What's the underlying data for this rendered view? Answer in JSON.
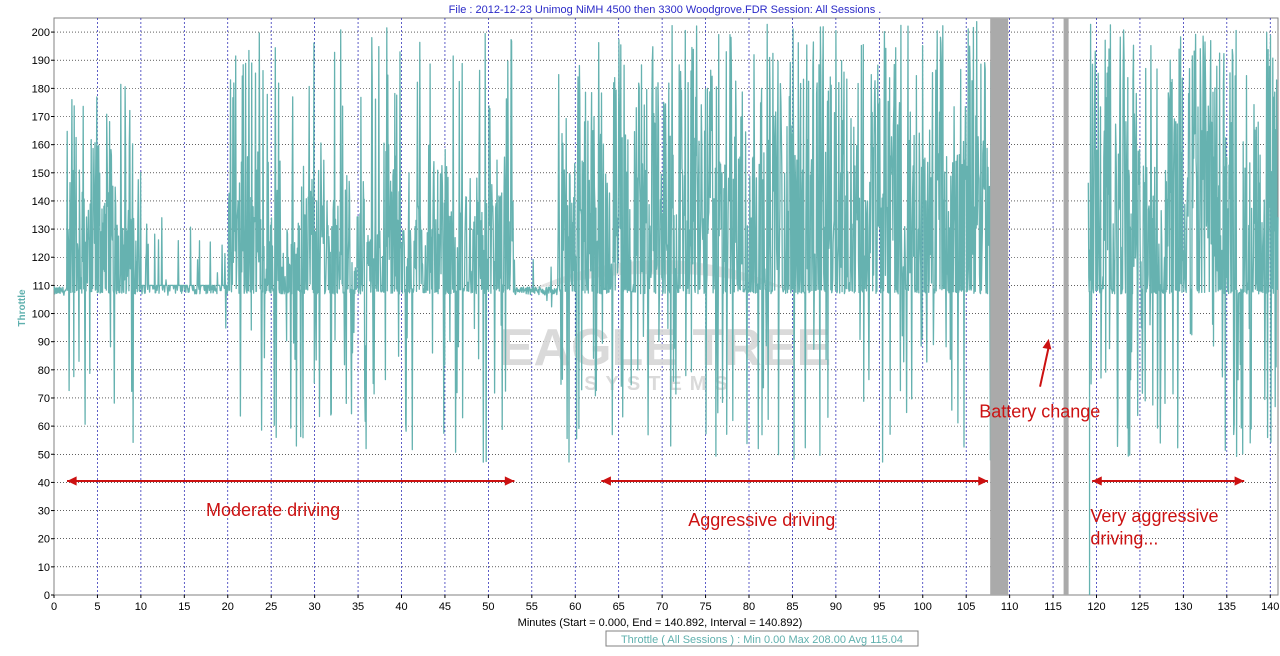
{
  "header": {
    "file_title": "File : 2012-12-23 Unimog NiMH 4500 then 3300 Woodgrove.FDR   Session: All Sessions ."
  },
  "watermark": {
    "main": "EAGLE TREE",
    "sub": "SYSTEMS"
  },
  "legend": {
    "text": "Throttle ( All Sessions ) : Min 0.00    Max 208.00    Avg 115.04"
  },
  "chart_data": {
    "type": "line",
    "xlabel": "Minutes (Start = 0.000,  End = 140.892,  Interval = 140.892)",
    "ylabel": "Throttle",
    "xlim": [
      0,
      140.892
    ],
    "ylim": [
      0,
      205
    ],
    "xticks": [
      0,
      5,
      10,
      15,
      20,
      25,
      30,
      35,
      40,
      45,
      50,
      55,
      60,
      65,
      70,
      75,
      80,
      85,
      90,
      95,
      100,
      105,
      110,
      115,
      120,
      125,
      130,
      135,
      140
    ],
    "yticks": [
      0,
      10,
      20,
      30,
      40,
      50,
      60,
      70,
      80,
      90,
      100,
      110,
      120,
      130,
      140,
      150,
      160,
      170,
      180,
      190,
      200
    ],
    "grid": true,
    "series": [
      {
        "name": "Throttle ( All Sessions )",
        "color": "#66b2b0",
        "baseline": 108,
        "note_segments": [
          {
            "x0": 0.0,
            "x1": 1.5,
            "lo": 105,
            "hi": 112,
            "avg_peak": 110
          },
          {
            "x0": 1.5,
            "x1": 10.0,
            "lo": 48,
            "hi": 183,
            "avg_peak": 150
          },
          {
            "x0": 10.0,
            "x1": 20.0,
            "lo": 90,
            "hi": 134,
            "avg_peak": 110
          },
          {
            "x0": 20.0,
            "x1": 53.0,
            "lo": 47,
            "hi": 202,
            "avg_peak": 150
          },
          {
            "x0": 53.0,
            "x1": 58.0,
            "lo": 100,
            "hi": 112,
            "avg_peak": 110
          },
          {
            "x0": 58.0,
            "x1": 108.0,
            "lo": 47,
            "hi": 204,
            "avg_peak": 180
          },
          {
            "x0": 108.0,
            "x1": 119.0,
            "lo": 0,
            "hi": 0,
            "avg_peak": 0
          },
          {
            "x0": 119.0,
            "x1": 140.9,
            "lo": 47,
            "hi": 203,
            "avg_peak": 185
          }
        ]
      }
    ],
    "stats": {
      "min": 0.0,
      "max": 208.0,
      "avg": 115.04
    },
    "session_markers": [
      108.8,
      116.5
    ],
    "annotations": [
      {
        "text": "Moderate driving",
        "range": [
          1.5,
          53.0
        ],
        "label_x": 17.5,
        "label_y": 28,
        "arrow_y": 40.5
      },
      {
        "text": "Aggressive driving",
        "range": [
          63.0,
          107.5
        ],
        "label_x": 73.0,
        "label_y": 24.5,
        "arrow_y": 40.5
      },
      {
        "text": "Battery change",
        "label_x": 106.5,
        "label_y": 63,
        "arrow_from": [
          113.5,
          74
        ],
        "arrow_to": [
          114.5,
          91
        ]
      },
      {
        "text": "Very aggressive",
        "range": [
          119.5,
          137.0
        ],
        "label_x": 119.3,
        "label_y": 26,
        "arrow_y": 40.5
      },
      {
        "text": "driving...",
        "label_x": 119.3,
        "label_y": 18
      }
    ]
  }
}
